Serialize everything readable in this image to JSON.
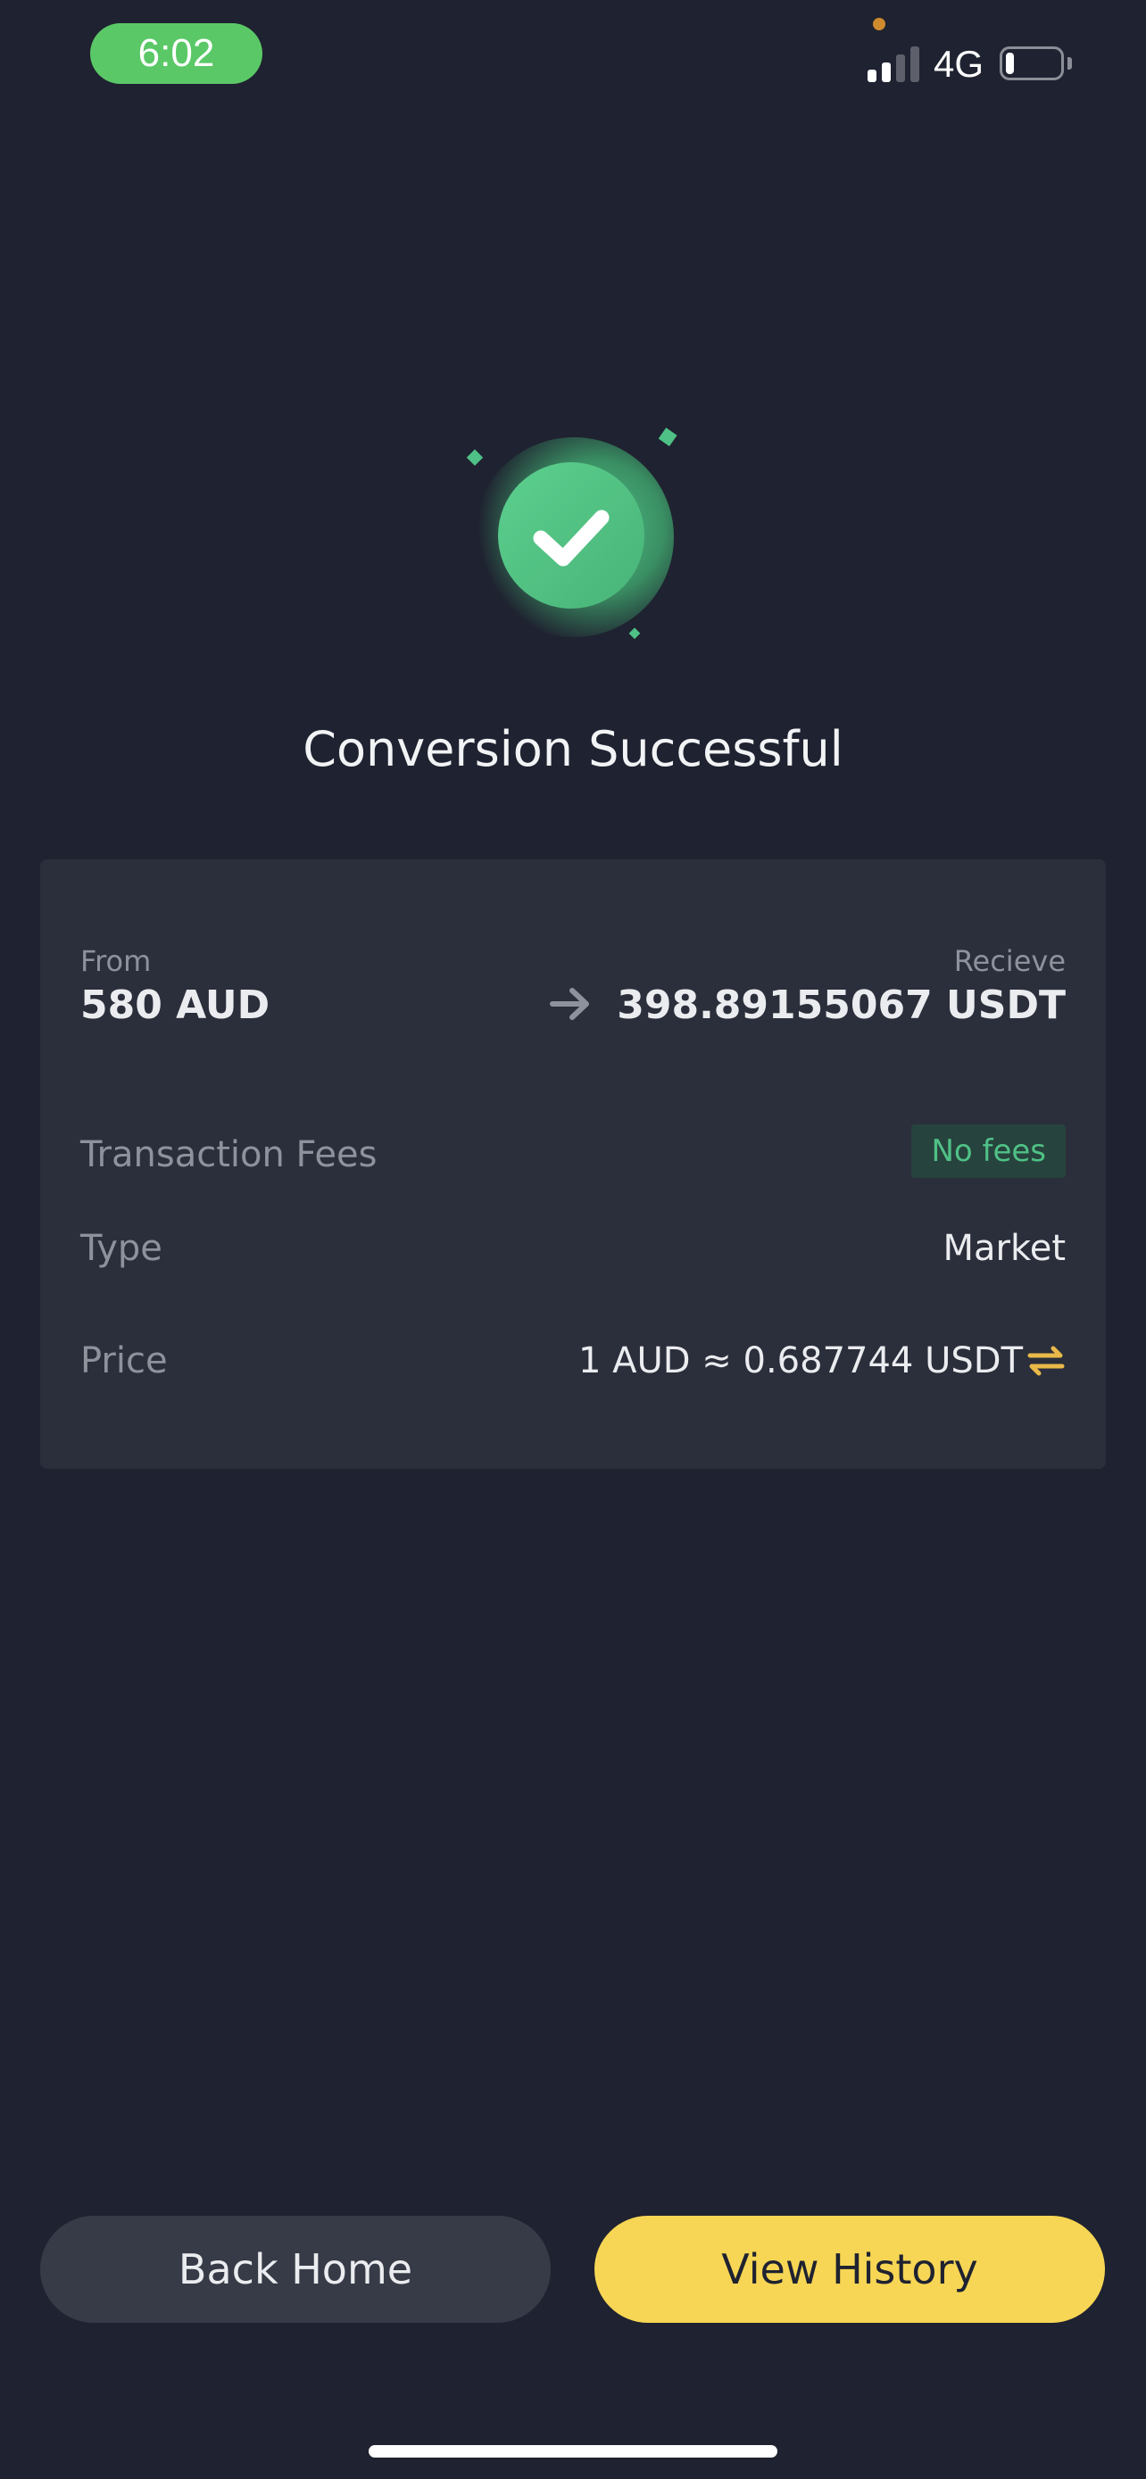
{
  "status_bar": {
    "time": "6:02",
    "network": "4G",
    "signal_bars_active": 2,
    "signal_bars_total": 4,
    "battery_level": 0.15,
    "icons": [
      "mic-indicator-dot",
      "signal-icon",
      "battery-icon"
    ]
  },
  "result": {
    "icon": "check-circle-icon",
    "title": "Conversion Successful"
  },
  "conversion": {
    "from_label": "From",
    "from_amount": "580 AUD",
    "arrow_icon": "arrow-right-icon",
    "receive_label": "Recieve",
    "receive_amount": "398.89155067 USDT"
  },
  "details": {
    "fees_label": "Transaction Fees",
    "fees_value": "No fees",
    "type_label": "Type",
    "type_value": "Market",
    "price_label": "Price",
    "price_value": "1 AUD ≈ 0.687744 USDT",
    "price_swap_icon": "swap-icon"
  },
  "actions": {
    "back_home": "Back Home",
    "view_history": "View History"
  },
  "colors": {
    "background": "#1f2230",
    "card": "#2b2f3b",
    "success_green": "#4fc186",
    "accent_yellow": "#f6d654",
    "swap_icon": "#e9b949"
  }
}
